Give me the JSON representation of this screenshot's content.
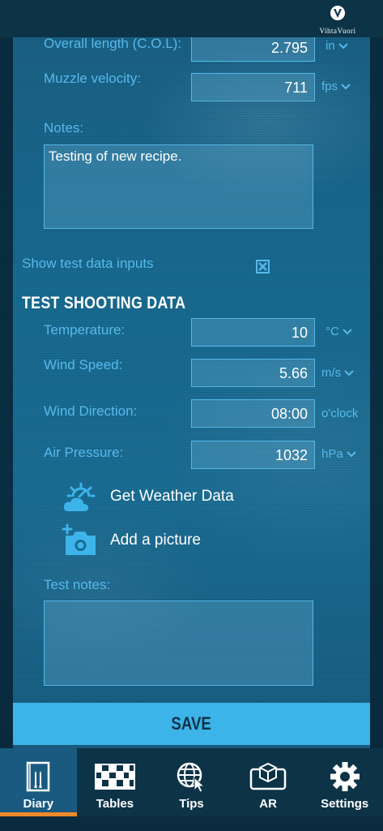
{
  "brand": {
    "name": "VihtaVuori"
  },
  "recipe": {
    "col_label": "Overall length (C.O.L):",
    "col_value": "2.795",
    "col_unit": "in",
    "muzzle_label": "Muzzle velocity:",
    "muzzle_value": "711",
    "muzzle_unit": "fps",
    "notes_label": "Notes:",
    "notes_value": "Testing of new recipe."
  },
  "toggle": {
    "label": "Show test data inputs",
    "checked": true
  },
  "test": {
    "title": "TEST SHOOTING DATA",
    "temp_label": "Temperature:",
    "temp_value": "10",
    "temp_unit": "°C",
    "wind_speed_label": "Wind Speed:",
    "wind_speed_value": "5.66",
    "wind_speed_unit": "m/s",
    "wind_dir_label": "Wind Direction:",
    "wind_dir_value": "08:00",
    "wind_dir_unit": "o'clock",
    "pressure_label": "Air Pressure:",
    "pressure_value": "1032",
    "pressure_unit": "hPa",
    "weather_label": "Get Weather Data",
    "picture_label": "Add a picture",
    "test_notes_label": "Test notes:",
    "test_notes_value": ""
  },
  "save_label": "SAVE",
  "nav": [
    {
      "label": "Diary",
      "icon": "diary-icon",
      "active": true
    },
    {
      "label": "Tables",
      "icon": "tables-icon",
      "active": false
    },
    {
      "label": "Tips",
      "icon": "tips-icon",
      "active": false
    },
    {
      "label": "AR",
      "icon": "ar-icon",
      "active": false
    },
    {
      "label": "Settings",
      "icon": "settings-icon",
      "active": false
    }
  ],
  "colors": {
    "accent": "#3cb4ea",
    "label": "#57b9ea",
    "active_tab_underline": "#f08a2a",
    "bar": "#0d3347"
  }
}
